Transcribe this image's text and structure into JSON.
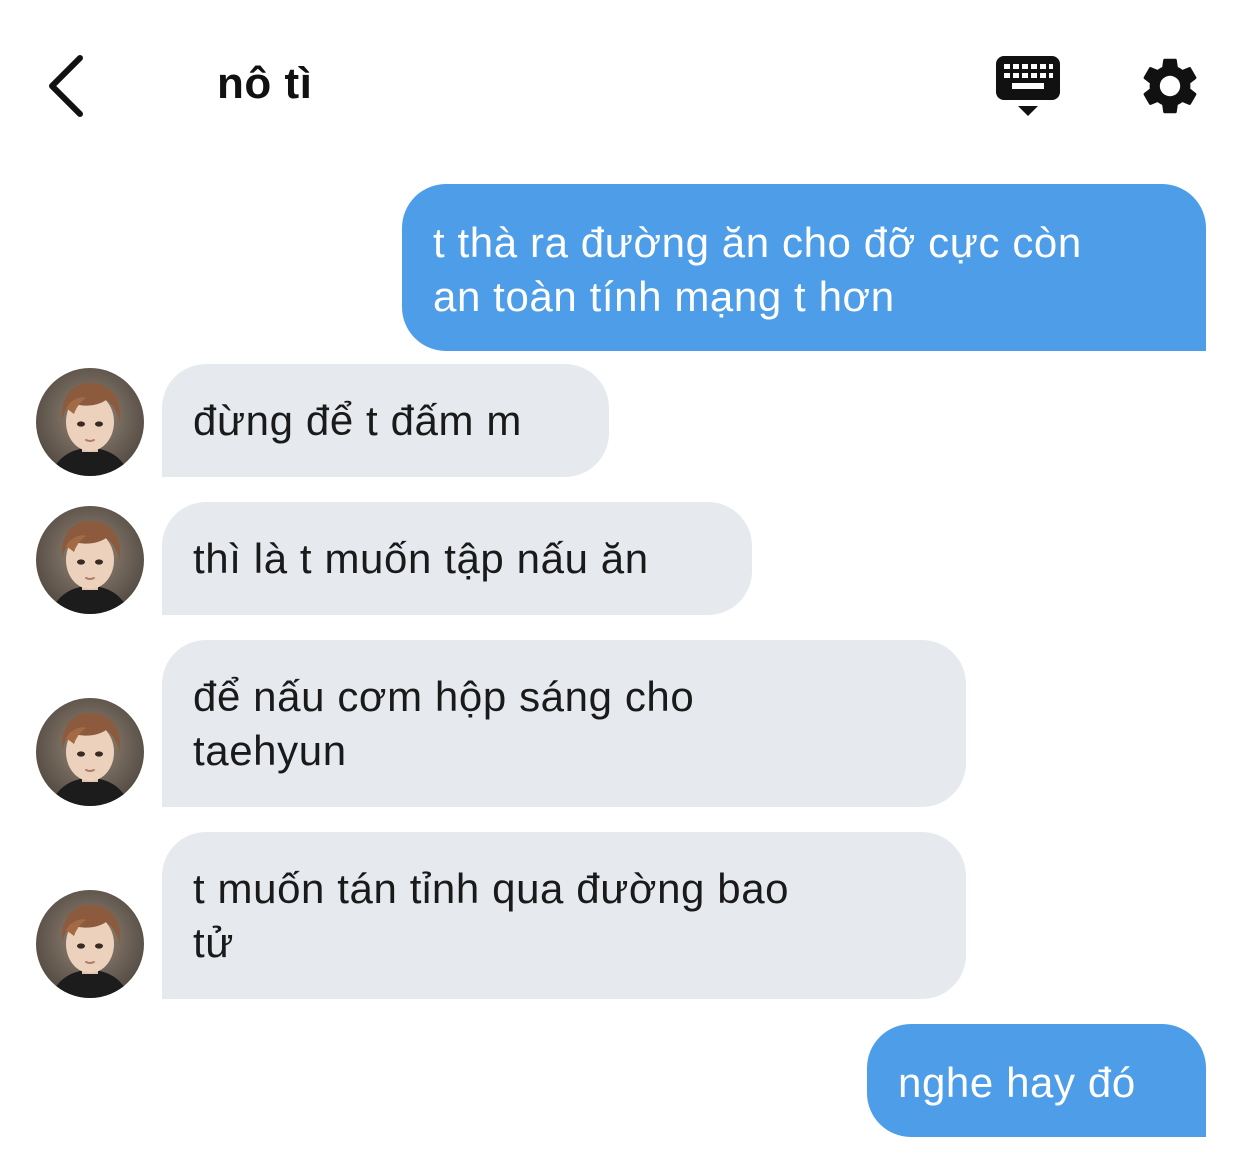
{
  "header": {
    "title": "nô tì",
    "back_icon": "chevron-left-icon",
    "keyboard_icon": "keyboard-icon",
    "settings_icon": "gear-icon"
  },
  "colors": {
    "outgoing_bubble": "#4d9de8",
    "incoming_bubble": "#e6e9ee",
    "text_dark": "#1c1c1e"
  },
  "messages": [
    {
      "direction": "outgoing",
      "lines": [
        "t thà ra đường ăn cho đỡ cực còn",
        "an toàn tính mạng t hơn"
      ]
    },
    {
      "direction": "incoming",
      "lines": [
        "đừng để t đấm m"
      ]
    },
    {
      "direction": "incoming",
      "lines": [
        "thì là t muốn tập nấu ăn"
      ]
    },
    {
      "direction": "incoming",
      "lines": [
        "để nấu cơm hộp sáng cho",
        "taehyun"
      ]
    },
    {
      "direction": "incoming",
      "lines": [
        "t muốn tán tỉnh qua đường bao",
        "tử"
      ]
    },
    {
      "direction": "outgoing",
      "lines": [
        "nghe hay đó"
      ]
    }
  ]
}
